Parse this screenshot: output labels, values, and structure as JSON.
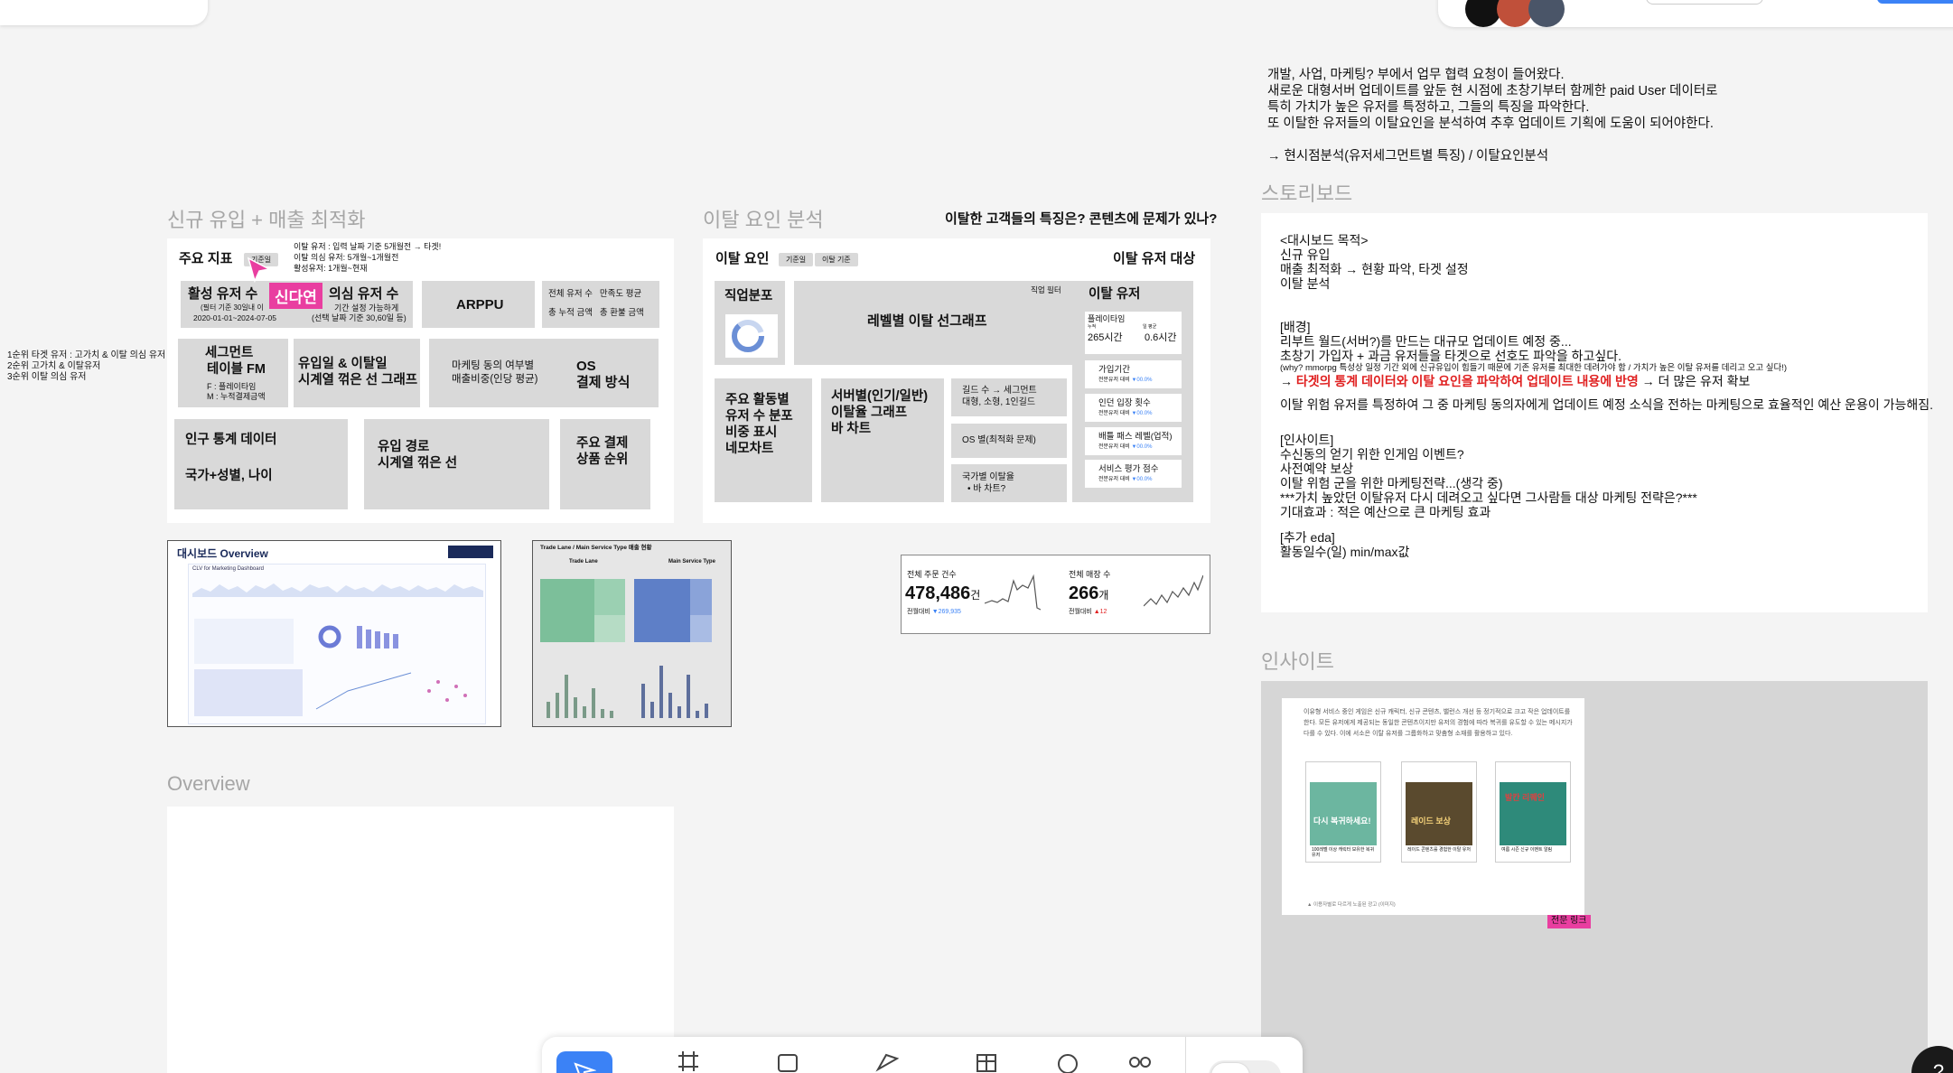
{
  "brief": {
    "line1": "개발, 사업, 마케팅? 부에서 업무 협력 요청이 들어왔다.",
    "line2": "새로운 대형서버 업데이트를 앞둔 현 시점에 초창기부터 함께한 paid User 데이터로",
    "line3": "특히 가치가 높은 유저를 특정하고, 그들의 특징을 파악한다.",
    "line4": "또 이탈한 유저들의 이탈요인을 분석하여 추후 업데이트 기획에 도움이 되어야한다.",
    "line5": "→ 현시점분석(유저세그먼트별 특징) / 이탈요인분석"
  },
  "frames": {
    "acquisition": "신규 유입 + 매출 최적화",
    "churn": "이탈 요인 분석",
    "churn_question": "이탈한 고객들의 특징은? 콘텐츠에 문제가 있나?",
    "storyboard": "스토리보드",
    "insight": "인사이트",
    "overview": "Overview"
  },
  "kpi_panel": {
    "header": "주요 지표",
    "tag": "기준일",
    "notes": [
      "이탈 유저 : 입력 날짜 기준 5개월전 → 타겟!",
      "이탈 의심 유저: 5개월~1개월전",
      "활성유저: 1개월~현재"
    ],
    "cursor_user": "신다연",
    "active_users": "활성 유저 수",
    "active_sub1": "(필터 기준 30일내 이",
    "active_sub2": "2020-01-01~2024-07-05",
    "suspect_users": "의심 유저 수",
    "suspect_sub1": "기간 설정 가능하게",
    "suspect_sub2": "(선택 날짜 기준 30,60일 등)",
    "arppu": "ARPPU",
    "total_users_line": "전체 유저 수   만족도 평균",
    "total_pay_line": "총 누적 금액   총 환불 금액",
    "segment_title1": "세그먼트",
    "segment_title2": "테이블 FM",
    "segment_f": "F : 플레이타임",
    "segment_m": "M : 누적결제금액",
    "inflow1": "유입일 & 이탈일",
    "inflow2": "시계열 꺾은 선 그래프",
    "marketing1": "마케팅 동의 여부별",
    "marketing2": "매출비중(인당 평균)",
    "os1": "OS",
    "os2": "결제 방식",
    "demo1": "인구 통계 데이터",
    "demo2": "국가+성별, 나이",
    "route1": "유입 경로",
    "route2": "시계열 꺾은 선",
    "product1": "주요 결제",
    "product2": "상품 순위"
  },
  "side_note": {
    "line1": "1순위 타겟 유저 : 고가치 & 이탈 의심 유저",
    "line2": "2순위 고가치 & 이탈유저",
    "line3": "3순위 이탈 의심 유저"
  },
  "churn_panel": {
    "header": "이탈 요인",
    "tag1": "기준일",
    "tag2": "이탈 기준",
    "target_header": "이탈 유저 대상",
    "job": "직업분포",
    "job_filter": "직업 필터",
    "level_line": "레벨별 이탈 선그래프",
    "activity1": "주요 활동별",
    "activity2": "유저 수 분포",
    "activity3": "비중 표시",
    "activity4": "네모차트",
    "server1": "서버별(인기/일반)",
    "server2": "이탈율 그래프",
    "server3": "바 차트",
    "guild1": "길드 수 → 세그먼트",
    "guild2": "대형, 소형, 1인길드",
    "os": "OS 별(최적화 문제)",
    "country1": "국가별 이탈율",
    "country2": "• 바 차트?",
    "churned_title": "이탈 유저",
    "playtime_label": "플레이타임",
    "playtime_a_label": "누적",
    "playtime_a": "265시간",
    "playtime_b_label": "일 평균",
    "playtime_b": "0.6시간",
    "metrics": [
      "가입기간",
      "인던 입장 횟수",
      "배틀 패스 레벨(업적)",
      "서비스 평가 점수"
    ],
    "metric_sub": "전분유저 대비",
    "metric_change": "▼00.0%"
  },
  "thumbs": {
    "overview_title": "대시보드 Overview",
    "overview_sub": "CLV for Marketing Dashboard",
    "trade_title": "Trade Lane / Main Service Type 매출 현황",
    "trade_left": "Trade Lane",
    "trade_right": "Main Service Type",
    "kpi1_label": "전체 주문 건수",
    "kpi1_value": "478,486",
    "kpi1_unit": "건",
    "kpi1_sub": "전월대비",
    "kpi1_delta": "▼269,935",
    "kpi2_label": "전체 매장 수",
    "kpi2_value": "266",
    "kpi2_unit": "개",
    "kpi2_sub": "전월대비",
    "kpi2_delta": "▲12"
  },
  "storyboard": {
    "purpose": "<대시보드 목적>",
    "p1": "신규 유입",
    "p2": "매출 최적화 → 현황 파악, 타겟 설정",
    "p3": "이탈 분석",
    "bg_title": "[배경]",
    "bg1": "리부트 월드(서버?)를 만드는 대규모 업데이트 예정 중...",
    "bg2": "초창기 가입자 + 과금 유저들을 타겟으로 선호도 파악을 하고싶다.",
    "bg3": "(why? mmorpg 특성상 일정 기간 외에 신규유입이 힘들기 때문에 기존 유저를 최대한 데려가야 함 / 가치가 높은 이탈 유저를 데리고 오고 싶다!)",
    "bg4_prefix": "→ ",
    "bg4_red": "타겟의 통계 데이터와 이탈 요인을 파악하여 업데이트 내용에 반영",
    "bg4_suffix": " → 더 많은 유저 확보",
    "bg5": "이탈 위험 유저를 특정하여 그 중 마케팅 동의자에게 업데이트 예정 소식을 전하는 마케팅으로 효율적인 예산 운용이 가능해짐.",
    "ins_title": "[인사이트]",
    "ins1": "수신동의 얻기 위한 인게임 이벤트?",
    "ins2": "사전예약 보상",
    "ins3": "이탈 위험 군을 위한 마케팅전략...(생각 중)",
    "ins4": "***가치 높았던 이탈유저 다시 데려오고 싶다면 그사람들 대상 마케팅 전략은?***",
    "ins5": "기대효과 : 적은 예산으로 큰 마케팅 효과",
    "eda_title": "[추가 eda]",
    "eda1": "활동일수(일) min/max값"
  },
  "insight_card": {
    "body": "이유형 서비스 중인 게임은 신규 캐릭터, 신규 콘텐츠, 밸런스 개선 등 정기적으로 크고 작은 업데이트를 한다. 모든 유저에게 제공되는 동일한 콘텐츠이지만 유저의 경험에 따라 복귀를 유도할 수 있는 메시지가 다를 수 있다. 이에 서소은 이탈 유저를 그룹화하고 맞춤형 소재를 활용하고 있다.",
    "post1": "다시 복귀하세요!",
    "post2": "레이드 보상",
    "post3": "발칸 리퀘인",
    "cap1": "100레벨 이상 캐릭터 보유한 복귀 유저",
    "cap2": "레이드 콘텐츠를 경험한 이탈 유저",
    "cap3": "여름 시즌 신규 이벤트 알림",
    "footer": "▲ 이용자별로 다르게 노출된 광고 (이미지)",
    "badge": "전문 링크"
  },
  "toolbar": {
    "tools": [
      "move-tool",
      "frame-tool",
      "shape-tool",
      "pen-tool",
      "table-tool",
      "comment-tool",
      "more-tool"
    ]
  },
  "colors": {
    "accent_blue": "#3b82f6",
    "cursor_pink": "#e93ea0",
    "red": "#e02020",
    "box_gray": "#d9d9d9"
  }
}
